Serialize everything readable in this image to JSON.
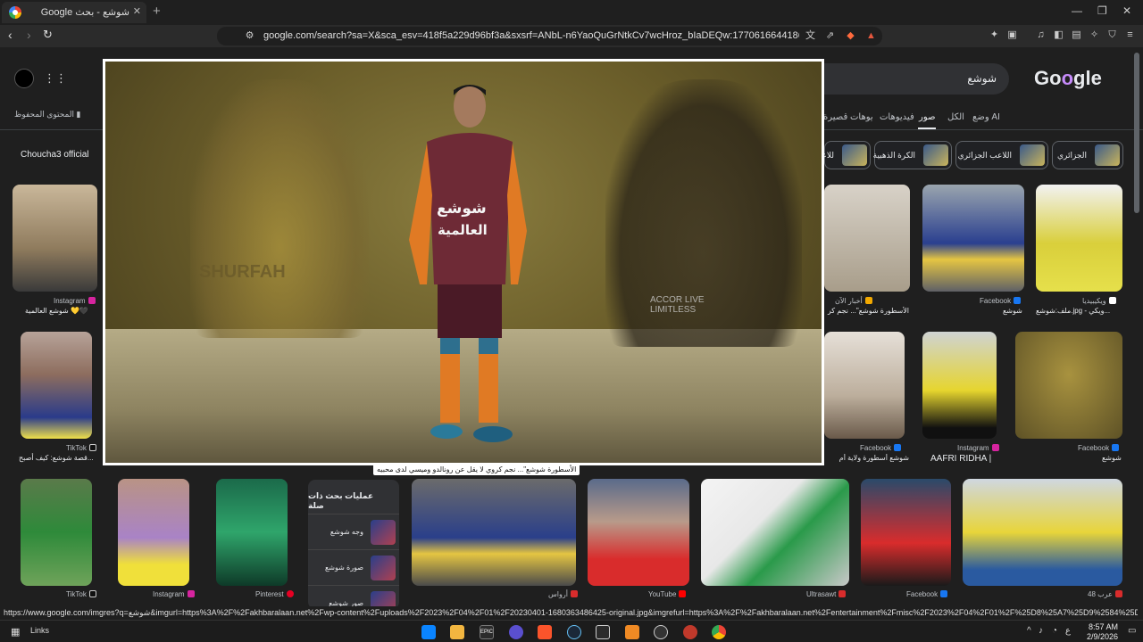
{
  "browser": {
    "tab_title": "شوشع - بحث Google",
    "tab_close": "✕",
    "new_tab": "+",
    "url": "google.com/search?sa=X&sca_esv=418f5a229d96bf3a&sxsrf=ANbL-n6YaoQuGrNtkCv7wcHroz_bIaDEQw:1770616644186&udm=2&fbs=ADc_l-..."
  },
  "google": {
    "search_query": "شوشع",
    "logo": [
      "G",
      "o",
      "o",
      "gle"
    ],
    "saved_content": "المحتوى المحفوظ",
    "nav_tabs": [
      "وضع AI",
      "الكل",
      "صور",
      "فيديوهات",
      "فيديوهات قصيرة"
    ],
    "chips": [
      "الجزائري",
      "اللاعب الجزائري",
      "الكرة الذهبية",
      "للاعب"
    ],
    "channel_label": "Choucha3 official",
    "row1": {
      "left_source": "Instagram",
      "left_caption": "شوشع العالمية 💛🖤",
      "right": [
        {
          "source": "أخبار الآن",
          "caption": "الأسطورة شوشع\"... نجم كر"
        },
        {
          "source": "Facebook",
          "caption": "شوشع"
        },
        {
          "source": "ويكيبيديا",
          "caption": "ملف:شوشع.jpg - ويكي..."
        }
      ]
    },
    "row2": {
      "left_source": "TikTok",
      "left_caption": "قصة شوشع: كيف أصبح...",
      "right": [
        {
          "source": "Facebook",
          "caption": "شوشع أسطورة ولاية أم"
        },
        {
          "source": "Instagram",
          "caption": "AAFRI RIDHA |"
        },
        {
          "source": "Facebook",
          "caption": "شوشع"
        }
      ]
    },
    "related": {
      "title": "عمليات بحث ذات صلة",
      "items": [
        "وجه شوشع",
        "صورة شوشع",
        "صور شوشع"
      ]
    },
    "row3_sources": [
      "TikTok",
      "Instagram",
      "Pinterest",
      "أرواس",
      "YouTube",
      "Ultrasawt",
      "Facebook",
      "عرب 48"
    ]
  },
  "overlay": {
    "caption": "الأسطورة شوشع\"... نجم كروي لا يقل عن رونالدو وميسي لدى محبيه",
    "jersey_text_1": "شوشع",
    "jersey_text_2": "العالمية",
    "bg_text_left": "SHURFAH",
    "bg_text_right": "ACCOR LIVE LIMITLESS"
  },
  "status_url": "https://www.google.com/imgres?q=شوشع&imgurl=https%3A%2F%2Fakhbaralaan.net%2Fwp-content%2Fuploads%2F2023%2F04%2F01%2F20230401-1680363486425-original.jpg&imgrefurl=https%3A%2F%2Fakhbaralaan.net%2Fentertainment%2Fmisc%2F2023%2F04%2F01%2F%25D8%25A7%25D9%2584%25D8%25A3%25D8%25B3%25D8%25B7%2...",
  "taskbar": {
    "links_label": "Links",
    "time": "8:57 AM",
    "date": "2/9/2026",
    "ime": "ع",
    "epic": "EPIC"
  },
  "colors": {
    "page_bg": "#1f1f1f",
    "accent": "#c58af9"
  }
}
